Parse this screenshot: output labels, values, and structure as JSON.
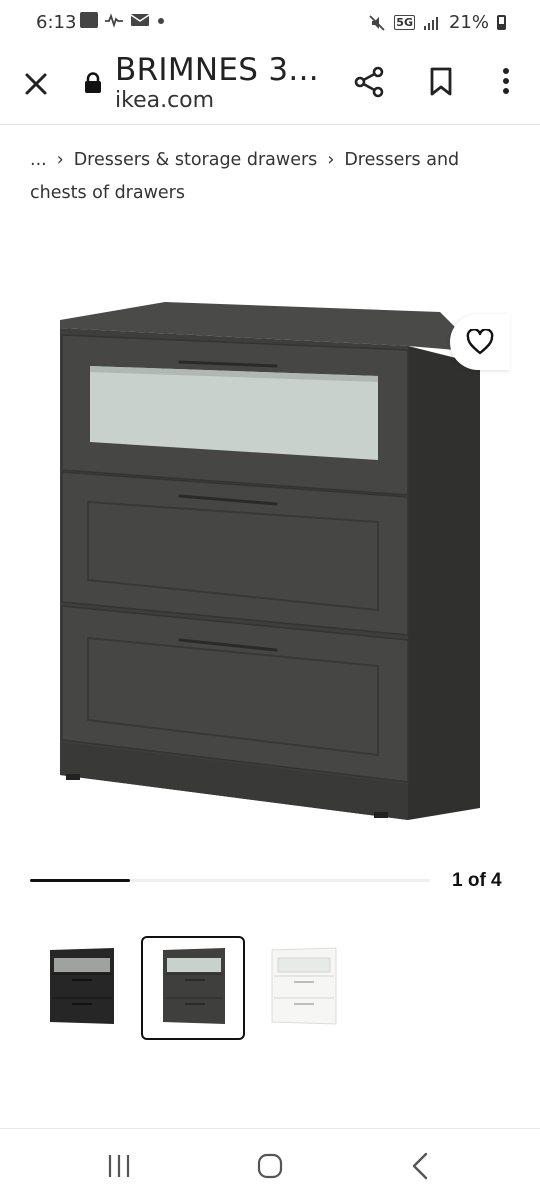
{
  "status_bar": {
    "time": "6:13",
    "network": "5G",
    "battery": "21%"
  },
  "browser": {
    "page_title": "BRIMNES 3...",
    "domain": "ikea.com"
  },
  "breadcrumb": {
    "ellipsis": "...",
    "items": [
      "Dressers & storage drawers",
      "Dressers and chests of drawers"
    ]
  },
  "gallery": {
    "current": 1,
    "total": 4,
    "pager_label": "1 of 4",
    "progress_fraction": 0.25,
    "thumbnails": [
      {
        "color": "black",
        "selected": false
      },
      {
        "color": "dark-gray",
        "selected": true
      },
      {
        "color": "white",
        "selected": false
      }
    ]
  },
  "colors": {
    "product_dark_gray": "#3f403d",
    "product_black": "#262626",
    "glass": "#c8d0cc",
    "accent": "#111111"
  }
}
